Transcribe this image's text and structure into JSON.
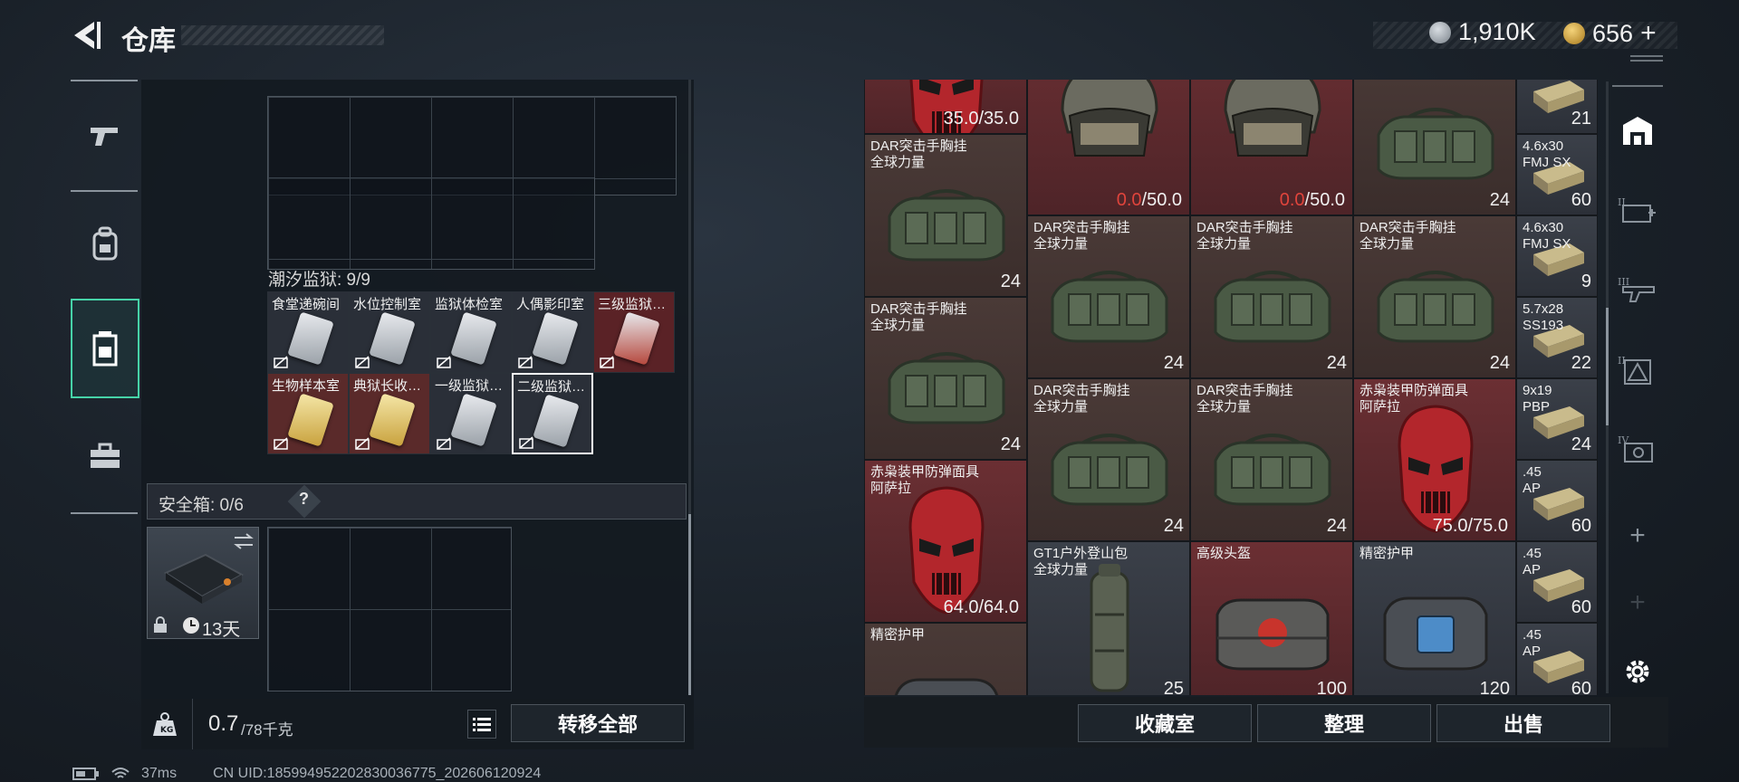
{
  "header": {
    "title": "仓库",
    "currency1": "1,910K",
    "currency2": "656",
    "plus": "+"
  },
  "left": {
    "tidal_prison_label": "潮汐监狱: 9/9",
    "keycards": [
      {
        "name": "食堂递碗间",
        "color": "grey"
      },
      {
        "name": "水位控制室",
        "color": "grey"
      },
      {
        "name": "监狱体检室",
        "color": "grey"
      },
      {
        "name": "人偶影印室",
        "color": "grey"
      },
      {
        "name": "三级监狱…",
        "color": "red"
      },
      {
        "name": "生物样本室",
        "color": "gold"
      },
      {
        "name": "典狱长收…",
        "color": "gold"
      },
      {
        "name": "一级监狱…",
        "color": "grey"
      },
      {
        "name": "二级监狱…",
        "color": "grey"
      }
    ],
    "safebox_label": "安全箱: 0/6",
    "safebox_help": "?",
    "safebox_time": "13天",
    "weight_value": "0.7",
    "weight_max": "/78千克",
    "transfer_all": "转移全部"
  },
  "inventory": {
    "top_partial": [
      {
        "dura": "35.0/35.0"
      },
      {
        "dura_bad": "0.0",
        "dura_max": "/50.0"
      },
      {
        "dura_bad": "0.0",
        "dura_max": "/50.0"
      },
      {
        "count": "24"
      },
      {
        "count": "21"
      }
    ],
    "items": [
      {
        "name": "DAR突击手胸挂\n全球力量",
        "count": "24"
      },
      {
        "name": "DAR突击手胸挂\n全球力量",
        "count": "24"
      },
      {
        "name": "DAR突击手胸挂\n全球力量",
        "count": "24"
      },
      {
        "name": "DAR突击手胸挂\n全球力量",
        "count": "24"
      },
      {
        "name": "DAR突击手胸挂\n全球力量",
        "count": "24"
      },
      {
        "name": "DAR突击手胸挂\n全球力量",
        "count": "24"
      },
      {
        "name": "DAR突击手胸挂\n全球力量",
        "count": "24"
      },
      {
        "name": "DAR突击手胸挂\n全球力量",
        "count": "24"
      },
      {
        "name": "赤枭装甲防弹面具\n阿萨拉",
        "dura": "64.0/64.0"
      },
      {
        "name": "赤枭装甲防弹面具\n阿萨拉",
        "dura": "75.0/75.0"
      },
      {
        "name": "GT1户外登山包\n全球力量",
        "count": "25"
      },
      {
        "name": "高级头盔",
        "count": "100"
      },
      {
        "name": "精密护甲",
        "count": "120"
      },
      {
        "name": "精密护甲"
      }
    ],
    "ammo": [
      {
        "name": "4.6x30\nFMJ SX",
        "count": "60"
      },
      {
        "name": "4.6x30\nFMJ SX",
        "count": "9"
      },
      {
        "name": "5.7x28\nSS193",
        "count": "22"
      },
      {
        "name": "9x19\nPBP",
        "count": "24"
      },
      {
        "name": ".45\nAP",
        "count": "60"
      },
      {
        "name": ".45\nAP",
        "count": "60"
      },
      {
        "name": ".45\nAP",
        "count": "60"
      }
    ]
  },
  "bottom_buttons": {
    "collection": "收藏室",
    "organize": "整理",
    "sell": "出售"
  },
  "footer": {
    "ping": "37ms",
    "uid": "CN UID:1859949522028300367​75_202606120924"
  }
}
